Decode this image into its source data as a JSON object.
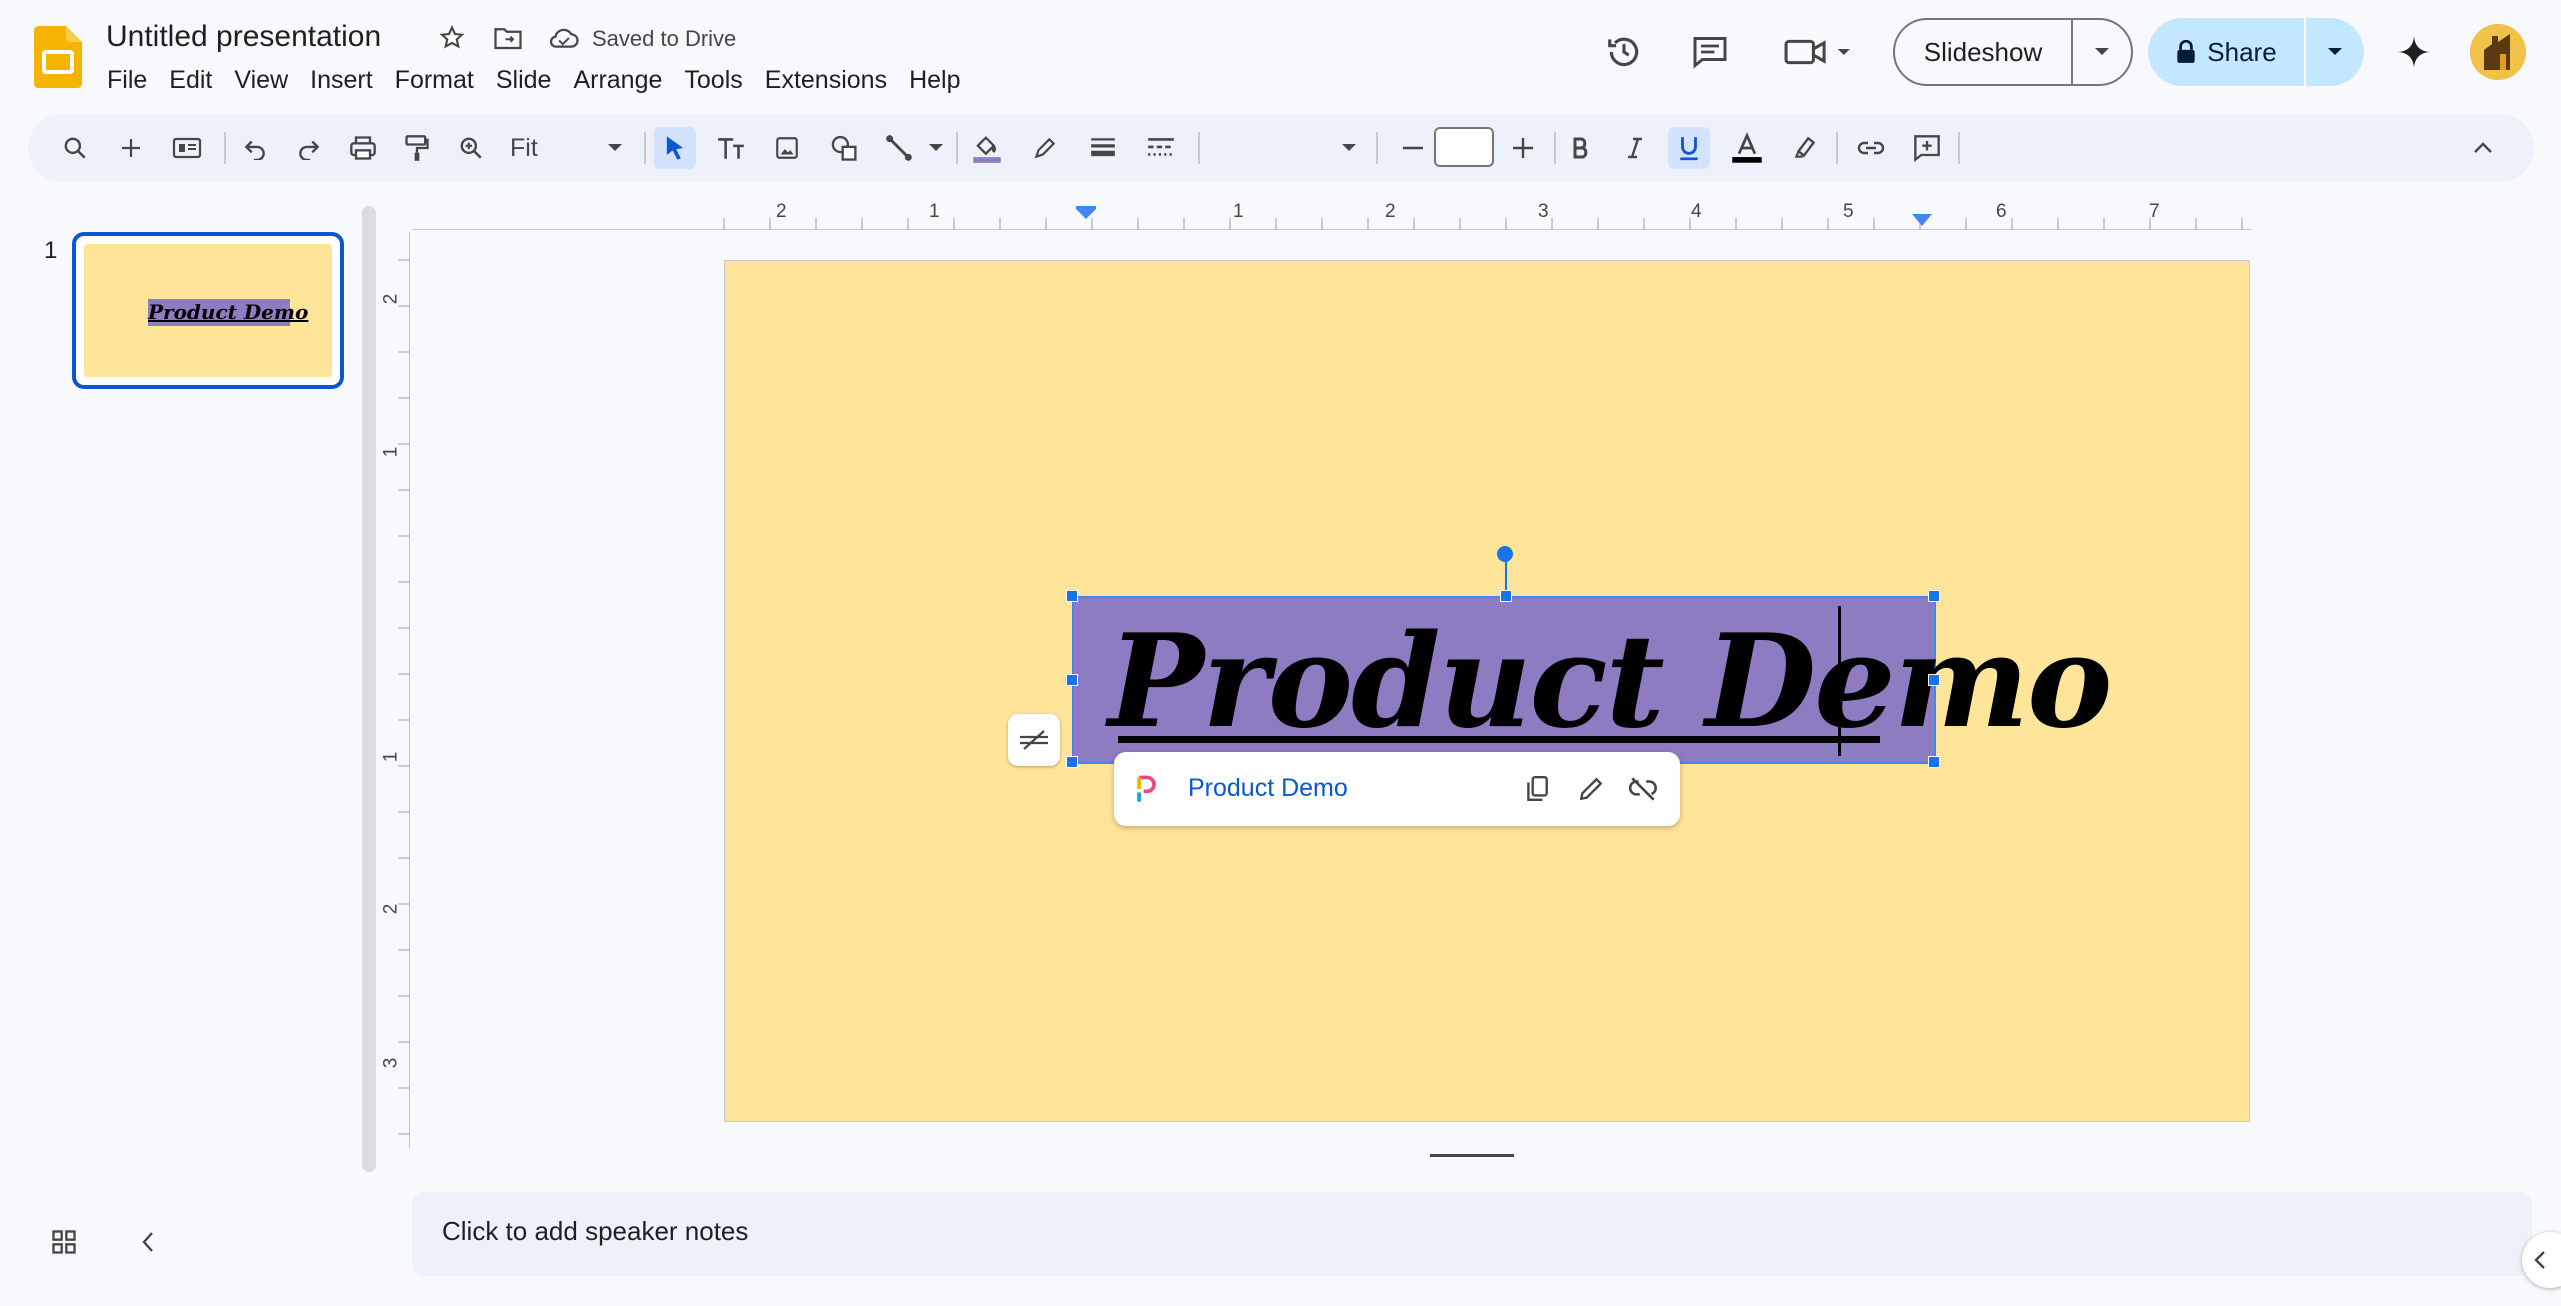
{
  "app": {
    "doc_title": "Untitled presentation",
    "save_status": "Saved to Drive"
  },
  "menu": [
    "File",
    "Edit",
    "View",
    "Insert",
    "Format",
    "Slide",
    "Arrange",
    "Tools",
    "Extensions",
    "Help"
  ],
  "header": {
    "slideshow_label": "Slideshow",
    "share_label": "Share"
  },
  "toolbar": {
    "zoom_value": "Fit",
    "font_name": "",
    "font_size": ""
  },
  "ruler": {
    "horizontal": [
      "2",
      "1",
      "1",
      "2",
      "3",
      "4",
      "5",
      "6",
      "7"
    ],
    "vertical": [
      "2",
      "1",
      "1",
      "2",
      "3"
    ]
  },
  "filmstrip": {
    "slide_number": "1",
    "thumb_title": "Product Demo"
  },
  "slide": {
    "title": "Product Demo",
    "background_color": "#ffe599",
    "textbox_fill": "#8e7cc3"
  },
  "link_popup": {
    "link_text": "Product Demo"
  },
  "notes": {
    "placeholder": "Click to add speaker notes"
  },
  "colors": {
    "accent": "#0b57d0",
    "selection": "#1a73e8",
    "share_bg": "#c2e7ff"
  }
}
